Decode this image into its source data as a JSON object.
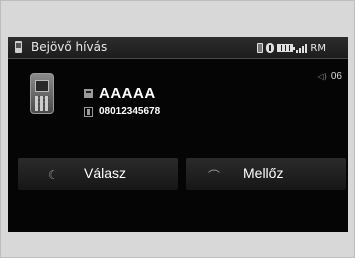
{
  "header": {
    "title": "Bejövő hívás",
    "status_text": "RM",
    "icons": [
      "phone-icon",
      "bluetooth-icon",
      "battery-icon",
      "signal-icon"
    ]
  },
  "caller": {
    "name": "AAAAA",
    "number": "08012345678",
    "icons": [
      "contact-icon",
      "mobile-number-icon",
      "mobile-phone-icon"
    ]
  },
  "volume": {
    "value": "06",
    "icon": "volume-icon"
  },
  "actions": {
    "answer_label": "Válasz",
    "answer_icon": "phone-answer-icon",
    "ignore_label": "Mellőz",
    "ignore_icon": "phone-hangup-icon"
  },
  "colors": {
    "screen_bg": "#050505",
    "frame_bg": "#d8d8d8",
    "text": "#ffffff",
    "icon_gray": "#9a9a9a"
  }
}
